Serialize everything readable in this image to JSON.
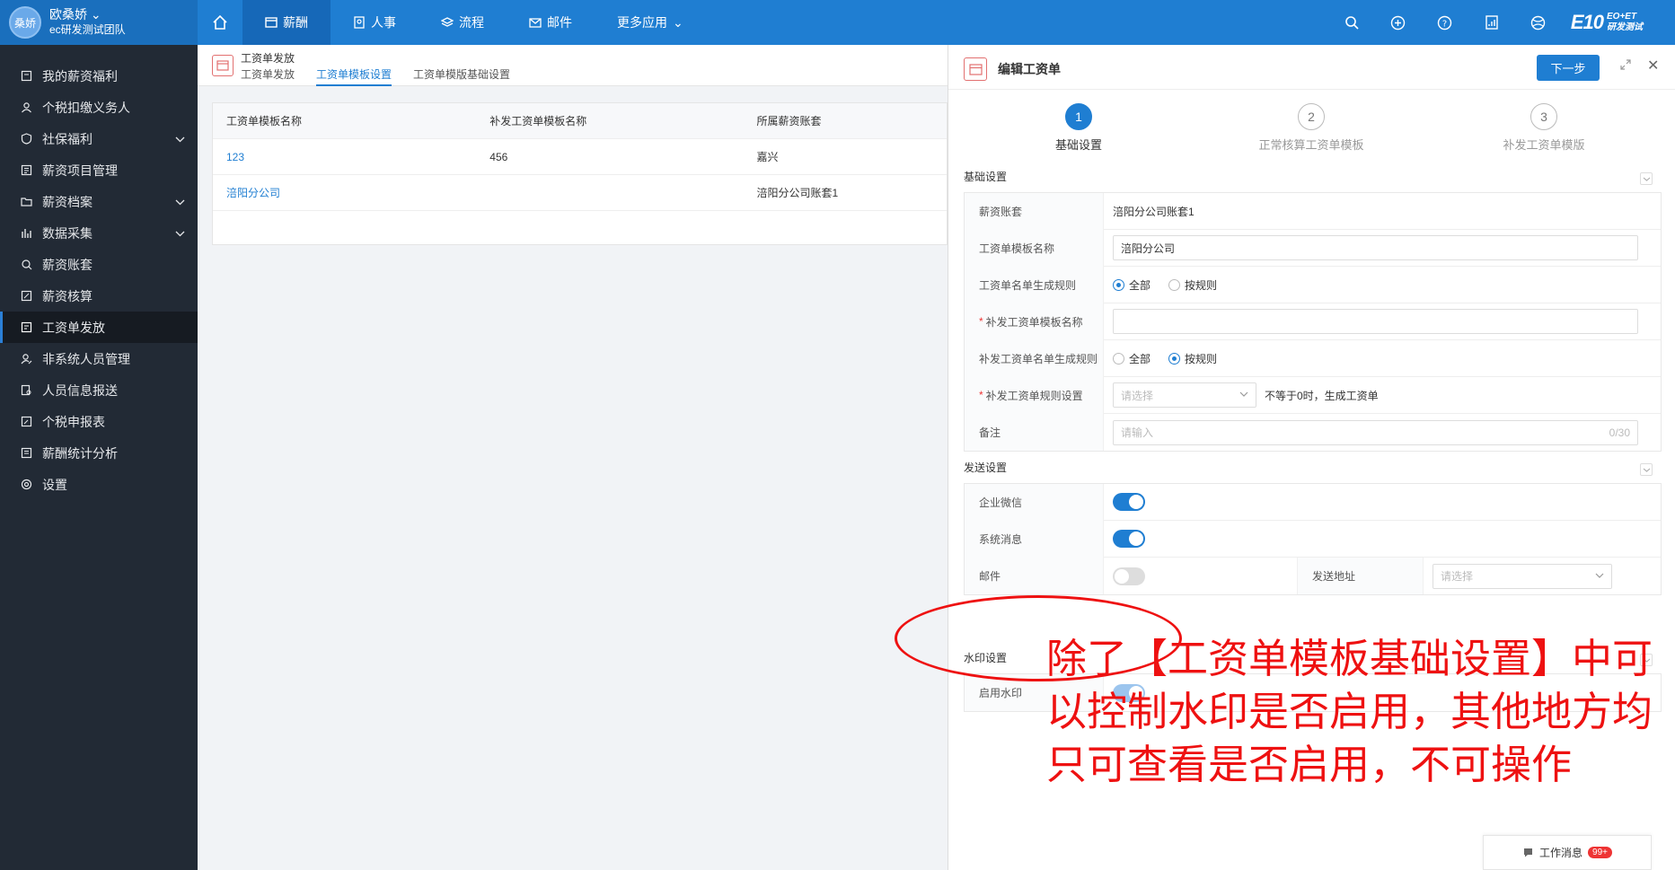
{
  "user": {
    "avatar_text": "桑娇",
    "name": "欧桑娇",
    "team": "ec研发测试团队"
  },
  "nav": {
    "items": [
      {
        "label": "薪酬",
        "icon": "wallet-icon"
      },
      {
        "label": "人事",
        "icon": "person-doc-icon"
      },
      {
        "label": "流程",
        "icon": "layers-icon"
      },
      {
        "label": "邮件",
        "icon": "mail-icon"
      },
      {
        "label": "更多应用",
        "icon": "chevron-down-icon"
      }
    ]
  },
  "brand": {
    "big": "E10",
    "top": "EO+ET",
    "bottom": "研发测试"
  },
  "sidebar": {
    "items": [
      {
        "label": "我的薪资福利"
      },
      {
        "label": "个税扣缴义务人"
      },
      {
        "label": "社保福利",
        "expandable": true
      },
      {
        "label": "薪资项目管理"
      },
      {
        "label": "薪资档案",
        "expandable": true
      },
      {
        "label": "数据采集",
        "expandable": true
      },
      {
        "label": "薪资账套"
      },
      {
        "label": "薪资核算"
      },
      {
        "label": "工资单发放",
        "active": true
      },
      {
        "label": "非系统人员管理"
      },
      {
        "label": "人员信息报送"
      },
      {
        "label": "个税申报表"
      },
      {
        "label": "薪酬统计分析"
      },
      {
        "label": "设置"
      }
    ]
  },
  "page": {
    "title": "工资单发放",
    "tabs": [
      "工资单发放",
      "工资单模板设置",
      "工资单模版基础设置"
    ],
    "table": {
      "headers": [
        "工资单模板名称",
        "补发工资单模板名称",
        "所属薪资账套"
      ],
      "rows": [
        [
          "123",
          "456",
          "嘉兴"
        ],
        [
          "涪阳分公司",
          "",
          "涪阳分公司账套1"
        ]
      ]
    }
  },
  "panel": {
    "title": "编辑工资单",
    "next_label": "下一步",
    "steps": [
      {
        "num": "1",
        "label": "基础设置"
      },
      {
        "num": "2",
        "label": "正常核算工资单模板"
      },
      {
        "num": "3",
        "label": "补发工资单模版"
      }
    ],
    "basic": {
      "title": "基础设置",
      "account_label": "薪资账套",
      "account_value": "涪阳分公司账套1",
      "template_name_label": "工资单模板名称",
      "template_name_value": "涪阳分公司",
      "list_rule_label": "工资单名单生成规则",
      "opt_all": "全部",
      "opt_rule": "按规则",
      "supp_name_label": "补发工资单模板名称",
      "supp_list_rule_label": "补发工资单名单生成规则",
      "supp_rule_label": "补发工资单规则设置",
      "select_placeholder": "请选择",
      "supp_rule_hint": "不等于0时，生成工资单",
      "remark_label": "备注",
      "remark_placeholder": "请输入",
      "remark_count": "0/30"
    },
    "send": {
      "title": "发送设置",
      "wechat_label": "企业微信",
      "sysmsg_label": "系统消息",
      "mail_label": "邮件",
      "address_label": "发送地址",
      "address_placeholder": "请选择"
    },
    "watermark": {
      "title": "水印设置",
      "enable_label": "启用水印"
    }
  },
  "annotation": "除了【工资单模板基础设置】中可以控制水印是否启用，其他地方均只可查看是否启用，不可操作",
  "messages": {
    "label": "工作消息",
    "badge": "99+"
  }
}
